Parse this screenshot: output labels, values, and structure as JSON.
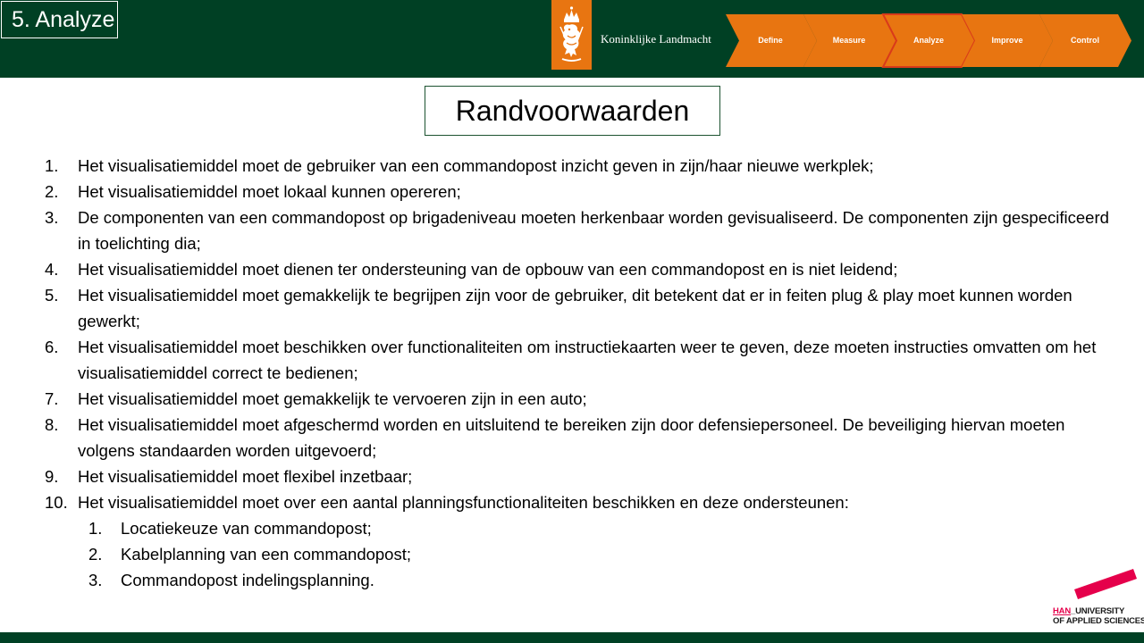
{
  "header": {
    "section_label": "5. Analyze",
    "org_name": "Koninklijke Landmacht",
    "emblem_icon": "lion-crest-icon",
    "colors": {
      "bar": "#004024",
      "orange": "#e87511",
      "active_outline": "#d93a1a"
    },
    "steps": [
      {
        "label": "Define",
        "active": false
      },
      {
        "label": "Measure",
        "active": false
      },
      {
        "label": "Analyze",
        "active": true
      },
      {
        "label": "Improve",
        "active": false
      },
      {
        "label": "Control",
        "active": false
      }
    ]
  },
  "slide": {
    "title": "Randvoorwaarden",
    "items": [
      {
        "num": "1.",
        "text": "Het visualisatiemiddel  moet de gebruiker van een commandopost inzicht geven in zijn/haar nieuwe werkplek;"
      },
      {
        "num": "2.",
        "text": "Het visualisatiemiddel  moet lokaal kunnen opereren;"
      },
      {
        "num": "3.",
        "text": "De componenten van een commandopost op brigadeniveau moeten herkenbaar worden gevisualiseerd. De componenten zijn gespecificeerd in toelichting  dia;"
      },
      {
        "num": "4.",
        "text": "Het visualisatiemiddel  moet dienen ter ondersteuning van de opbouw van een commandopost en is niet leidend;"
      },
      {
        "num": "5.",
        "text": "Het visualisatiemiddel  moet gemakkelijk te begrijpen zijn voor de gebruiker, dit betekent dat er in feiten plug & play moet kunnen worden gewerkt;"
      },
      {
        "num": "6.",
        "text": "Het visualisatiemiddel  moet beschikken over functionaliteiten  om instructiekaarten weer te geven, deze moeten instructies omvatten om het visualisatiemiddel  correct te bedienen;"
      },
      {
        "num": "7.",
        "text": "Het visualisatiemiddel  moet gemakkelijk  te vervoeren zijn in een auto;"
      },
      {
        "num": "8.",
        "text": "Het visualisatiemiddel  moet afgeschermd worden en uitsluitend  te bereiken zijn door defensiepersoneel. De beveiliging  hiervan moeten volgens standaarden worden uitgevoerd;"
      },
      {
        "num": "9.",
        "text": "Het visualisatiemiddel  moet flexibel inzetbaar;"
      },
      {
        "num": "10.",
        "text": "Het visualisatiemiddel  moet over een aantal planningsfunctionaliteiten  beschikken en deze ondersteunen:"
      }
    ],
    "subitems": [
      {
        "num": "1.",
        "text": "Locatiekeuze van commandopost;"
      },
      {
        "num": "2.",
        "text": "Kabelplanning van een commandopost;"
      },
      {
        "num": "3.",
        "text": "Commandopost indelingsplanning."
      }
    ]
  },
  "footer_logo": {
    "brand": "HAN",
    "line1_rest": "_UNIVERSITY",
    "line2": "OF APPLIED SCIENCES",
    "brand_color": "#e5004b"
  }
}
